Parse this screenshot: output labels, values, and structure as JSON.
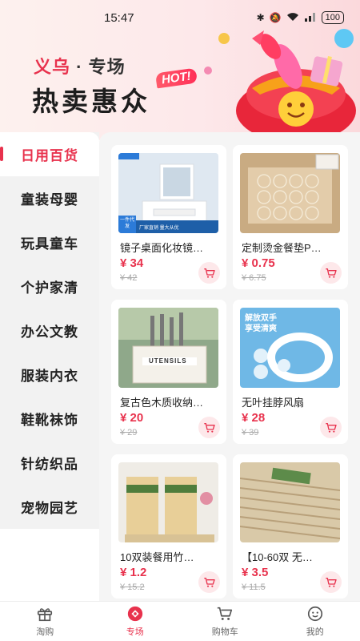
{
  "status_bar": {
    "time": "15:47",
    "battery": "100"
  },
  "banner": {
    "subtitle_city": "义乌",
    "subtitle_dot": "·",
    "subtitle_rest": "专场",
    "title": "热卖惠众",
    "badge": "HOT!"
  },
  "sidebar": {
    "items": [
      {
        "label": "日用百货"
      },
      {
        "label": "童装母婴"
      },
      {
        "label": "玩具童车"
      },
      {
        "label": "个护家清"
      },
      {
        "label": "办公文教"
      },
      {
        "label": "服装内衣"
      },
      {
        "label": "鞋靴袜饰"
      },
      {
        "label": "针纺织品"
      },
      {
        "label": "宠物园艺"
      }
    ],
    "active_index": 0
  },
  "products": [
    {
      "name": "镜子桌面化妆镜…",
      "price": "¥ 34",
      "original_price": "¥ 42",
      "image_tag": "一件代发",
      "image_caption": "厂家直销 量大从优"
    },
    {
      "name": "定制烫金餐垫P…",
      "price": "¥ 0.75",
      "original_price": "¥ 6.75"
    },
    {
      "name": "复古色木质收纳…",
      "price": "¥ 20",
      "original_price": "¥ 29",
      "image_text": "UTENSILS"
    },
    {
      "name": "无叶挂脖风扇 ",
      "price": "¥ 28",
      "original_price": "¥ 39",
      "image_text_1": "解放双手",
      "image_text_2": "享受清爽"
    },
    {
      "name": "10双装餐用竹…",
      "price": "¥ 1.2",
      "original_price": "¥ 15.2"
    },
    {
      "name": "【10-60双 无…",
      "price": "¥ 3.5",
      "original_price": "¥ 11.5"
    }
  ],
  "bottom_nav": {
    "items": [
      {
        "label": "淘购",
        "icon": "gift-icon"
      },
      {
        "label": "专场",
        "icon": "special-icon"
      },
      {
        "label": "购物车",
        "icon": "cart-icon"
      },
      {
        "label": "我的",
        "icon": "profile-icon"
      }
    ],
    "active_index": 1
  },
  "colors": {
    "accent": "#e8324d",
    "sidebar_bg": "#f2f2f2",
    "content_bg": "#f5f5f5"
  }
}
